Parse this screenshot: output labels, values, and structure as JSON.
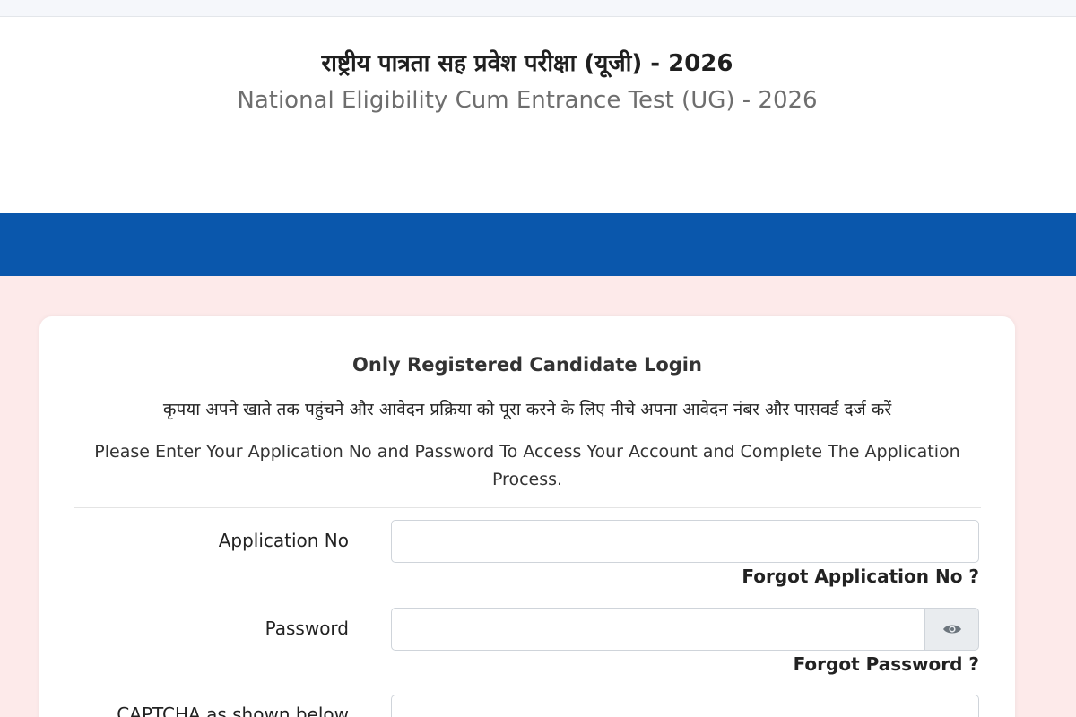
{
  "header": {
    "title_hi": "राष्ट्रीय पात्रता सह प्रवेश परीक्षा (यूजी) - 2026",
    "title_en": "National Eligibility Cum Entrance Test (UG) - 2026"
  },
  "login": {
    "heading": "Only Registered Candidate Login",
    "instruction_hi": "कृपया अपने खाते तक पहुंचने और आवेदन प्रक्रिया को पूरा करने के लिए नीचे अपना आवेदन नंबर और पासवर्ड दर्ज करें",
    "instruction_en": "Please Enter Your Application No and Password To Access Your Account and Complete The Application Process.",
    "application_no_label": "Application No",
    "application_no_value": "",
    "forgot_application_no": "Forgot Application No ?",
    "password_label": "Password",
    "password_value": "",
    "forgot_password": "Forgot Password ?",
    "captcha_label": "CAPTCHA as shown below",
    "captcha_value": ""
  },
  "icons": {
    "show_password": "eye-icon"
  },
  "colors": {
    "navbar": "#0a57ac",
    "page_background": "#fdeaea",
    "card_background": "#ffffff"
  }
}
